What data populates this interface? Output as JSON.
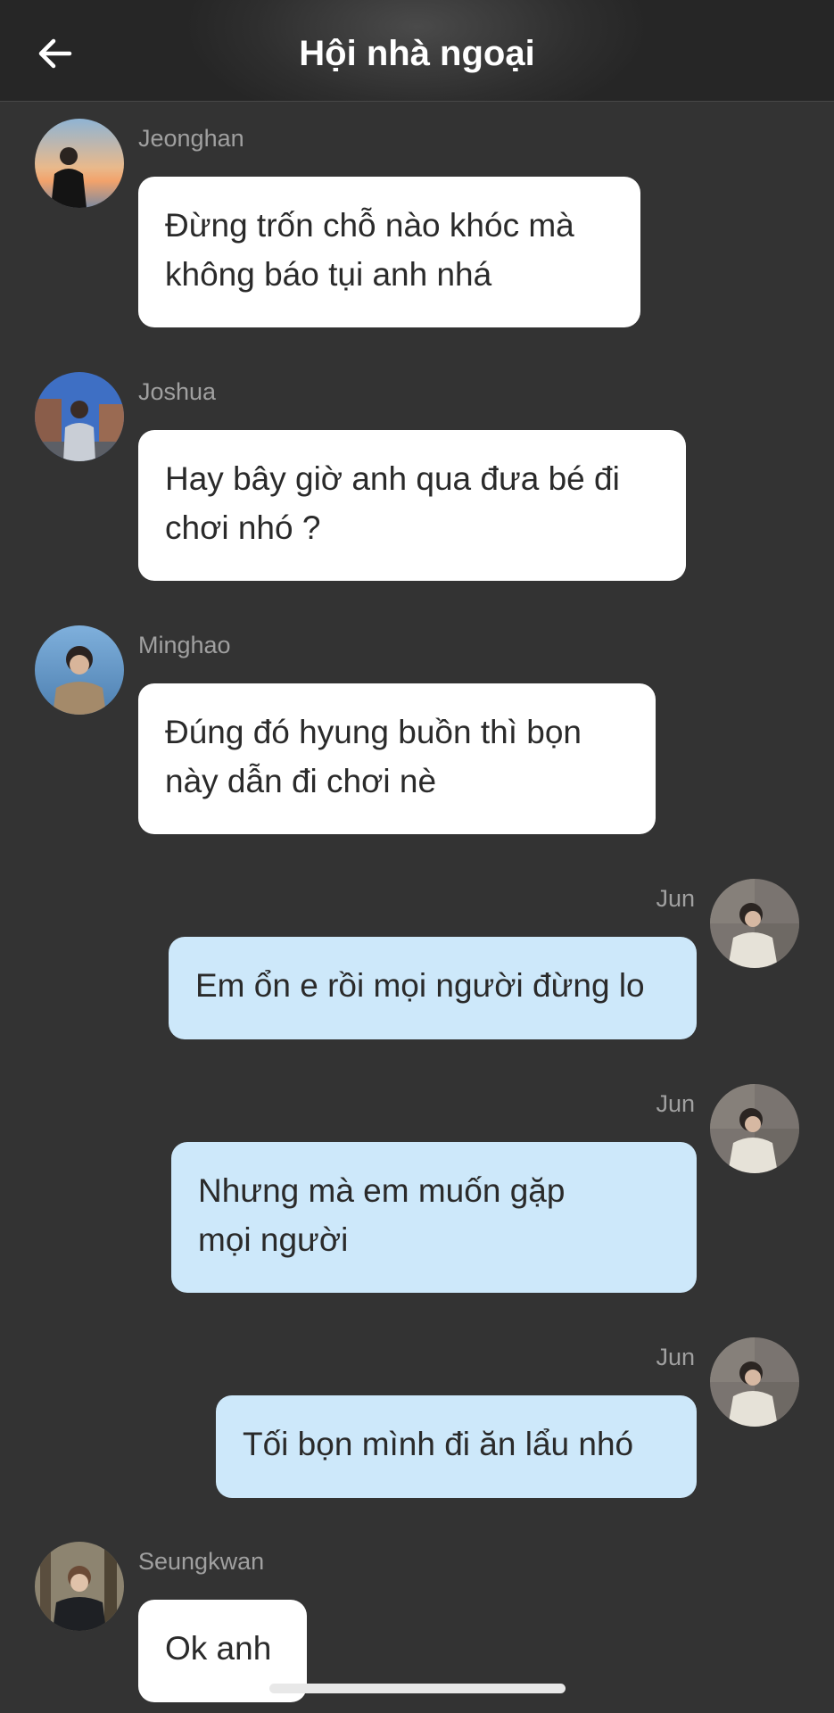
{
  "header": {
    "title": "Hội nhà ngoại"
  },
  "messages": [
    {
      "sender": "Jeonghan",
      "text": "Đừng trốn chỗ nào khóc mà\nkhông báo tụi anh nhá",
      "direction": "incoming",
      "avatar": "avatar-jeonghan"
    },
    {
      "sender": "Joshua",
      "text": "Hay bây giờ anh qua đưa bé đi\nchơi nhó ?",
      "direction": "incoming",
      "avatar": "avatar-joshua"
    },
    {
      "sender": "Minghao",
      "text": "Đúng đó hyung buồn thì bọn\nnày dẫn đi chơi nè",
      "direction": "incoming",
      "avatar": "avatar-minghao"
    },
    {
      "sender": "Jun",
      "text": "Em ổn e rồi mọi người đừng lo",
      "direction": "outgoing",
      "avatar": "avatar-jun"
    },
    {
      "sender": "Jun",
      "text": "Nhưng mà em muốn gặp\nmọi người",
      "direction": "outgoing",
      "avatar": "avatar-jun"
    },
    {
      "sender": "Jun",
      "text": "Tối bọn mình đi ăn lẩu nhó",
      "direction": "outgoing",
      "avatar": "avatar-jun"
    },
    {
      "sender": "Seungkwan",
      "text": "Ok anh",
      "direction": "incoming",
      "avatar": "avatar-seungkwan"
    }
  ],
  "colors": {
    "background": "#333333",
    "incoming_bubble": "#ffffff",
    "outgoing_bubble": "#cde8fa",
    "sender_name": "#a0a0a0"
  },
  "icons": {
    "back": "arrow-left-icon"
  }
}
